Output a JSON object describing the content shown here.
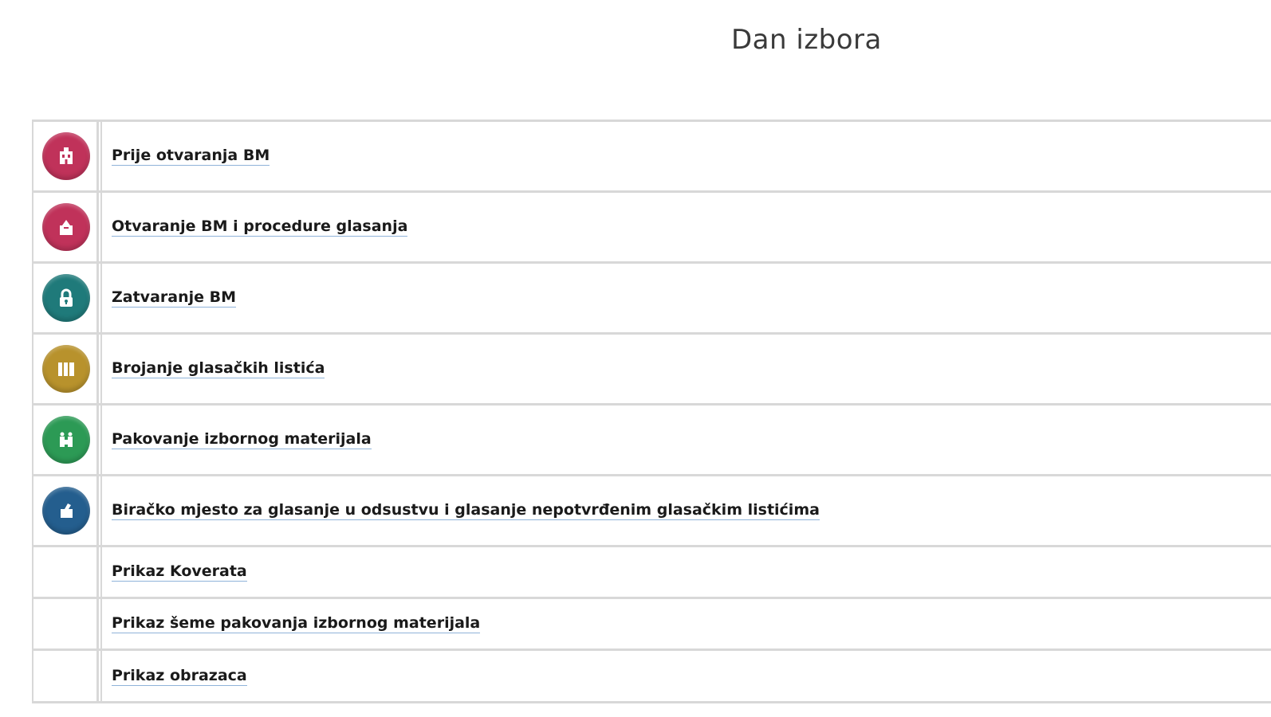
{
  "page": {
    "title": "Dan izbora"
  },
  "menu": {
    "items": [
      {
        "label": "Prije otvaranja BM",
        "icon": "polling-station-icon",
        "color": "#c0325a"
      },
      {
        "label": "Otvaranje BM i procedure glasanja",
        "icon": "ballot-box-icon",
        "color": "#c0325a"
      },
      {
        "label": "Zatvaranje BM",
        "icon": "lock-icon",
        "color": "#1f7a7a"
      },
      {
        "label": "Brojanje glasačkih listića",
        "icon": "ballots-stack-icon",
        "color": "#b8922c"
      },
      {
        "label": "Pakovanje izbornog materijala",
        "icon": "packaging-icon",
        "color": "#2c9a55"
      },
      {
        "label": "Biračko mjesto za glasanje u odsustvu i glasanje nepotvrđenim glasačkim listićima",
        "icon": "absentee-ballot-icon",
        "color": "#245e8e"
      },
      {
        "label": "Prikaz Koverata"
      },
      {
        "label": "Prikaz šeme pakovanja izbornog materijala"
      },
      {
        "label": "Prikaz obrazaca"
      }
    ]
  }
}
